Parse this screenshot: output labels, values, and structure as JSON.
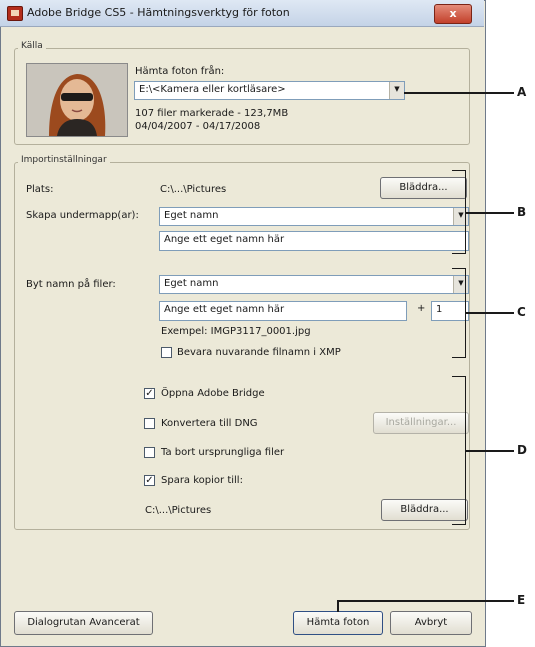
{
  "window": {
    "title": "Adobe Bridge CS5 - Hämtningsverktyg för foton",
    "close_glyph": "x"
  },
  "source": {
    "legend": "Källa",
    "get_from_label": "Hämta foton från:",
    "device_value": "E:\\<Kamera eller kortläsare>",
    "summary": "107 filer markerade - 123,7MB",
    "date_range": "04/04/2007 - 04/17/2008"
  },
  "import": {
    "legend": "Importinställningar",
    "location_label": "Plats:",
    "location_value": "C:\\...\\Pictures",
    "browse_label": "Bläddra...",
    "subfolder_label": "Skapa undermapp(ar):",
    "subfolder_value": "Eget namn",
    "subfolder_name_placeholder": "Ange ett eget namn här",
    "rename_label": "Byt namn på filer:",
    "rename_value": "Eget namn",
    "rename_name_placeholder": "Ange ett eget namn här",
    "plus_sign": "+",
    "sequence_value": "1",
    "example_text": "Exempel: IMGP3117_0001.jpg",
    "preserve_label": "Bevara nuvarande filnamn i XMP",
    "open_bridge_label": "Öppna Adobe Bridge",
    "convert_dng_label": "Konvertera till DNG",
    "settings_label": "Inställningar...",
    "delete_originals_label": "Ta bort ursprungliga filer",
    "save_copies_label": "Spara kopior till:",
    "copies_path": "C:\\...\\Pictures",
    "copies_browse_label": "Bläddra...",
    "check_mark": "✓"
  },
  "footer": {
    "advanced_label": "Dialogrutan Avancerat",
    "get_photos_label": "Hämta foton",
    "cancel_label": "Avbryt"
  },
  "callouts": {
    "a": "A",
    "b": "B",
    "c": "C",
    "d": "D",
    "e": "E"
  }
}
